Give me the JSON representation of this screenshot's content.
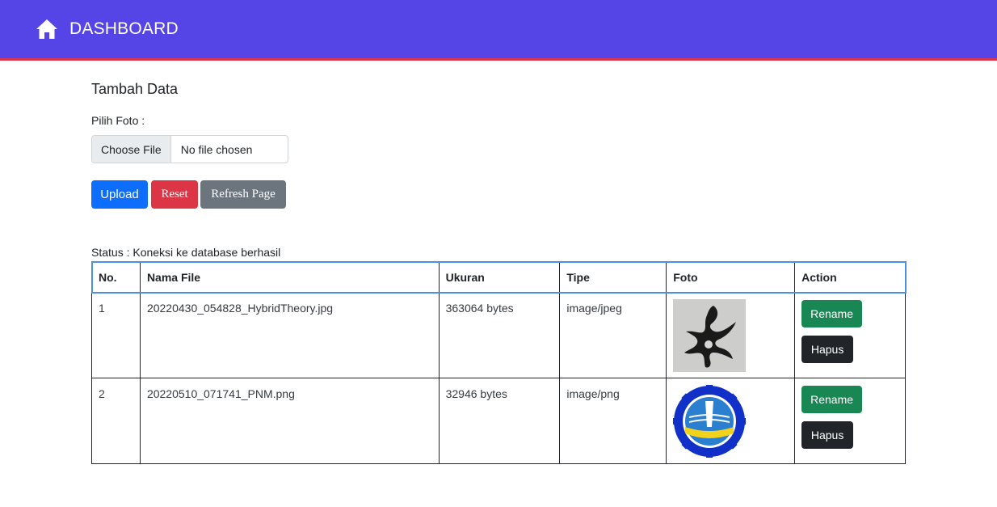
{
  "navbar": {
    "title": "DASHBOARD",
    "color": "#5544e6",
    "accent": "#d8364f"
  },
  "form": {
    "title": "Tambah Data",
    "label": "Pilih Foto :",
    "choose_button": "Choose File",
    "file_status": "No file chosen",
    "upload_label": "Upload",
    "reset_label": "Reset",
    "refresh_label": "Refresh Page"
  },
  "status": "Status : Koneksi ke database berhasil",
  "table": {
    "headers": [
      "No.",
      "Nama File",
      "Ukuran",
      "Tipe",
      "Foto",
      "Action"
    ],
    "rows": [
      {
        "no": "1",
        "name": "20220430_054828_HybridTheory.jpg",
        "size": "363064 bytes",
        "type": "image/jpeg",
        "rename": "Rename",
        "hapus": "Hapus"
      },
      {
        "no": "2",
        "name": "20220510_071741_PNM.png",
        "size": "32946 bytes",
        "type": "image/png",
        "rename": "Rename",
        "hapus": "Hapus"
      }
    ]
  }
}
